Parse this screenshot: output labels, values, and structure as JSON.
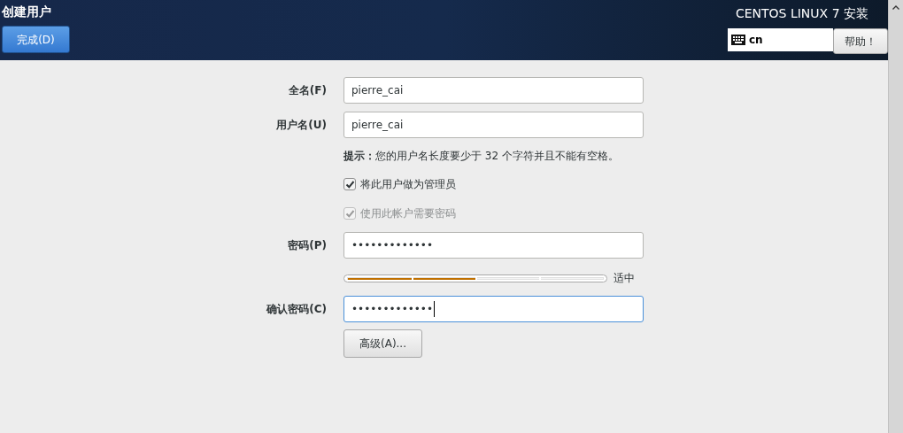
{
  "header": {
    "title": "创建用户",
    "done_button": "完成(D)",
    "product": "CENTOS LINUX 7 安装",
    "keyboard_layout": "cn",
    "help_button": "帮助！"
  },
  "fields": [
    {
      "label": "全名(F)",
      "value": "pierre_cai",
      "focused": false
    },
    {
      "label": "用户名(U)",
      "value": "pierre_cai",
      "focused": false
    }
  ],
  "hint": "**提示：**您的用户名长度要少于 32 个字符并且不能有空格。",
  "checkboxes": [
    {
      "label": "将此用户做为管理员",
      "checked": true,
      "disabled": false
    },
    {
      "label": "使用此帐户需要密码",
      "checked": true,
      "disabled": true
    }
  ],
  "password": {
    "label": "密码(P)",
    "value": "•••••••••••••",
    "focused": false
  },
  "strength": {
    "level": 0.5,
    "reading": "适中"
  },
  "confirm": {
    "label": "确认密码(C)",
    "value": "•••••••••••••",
    "focused": true
  },
  "advanced_button": "高级(A)..."
}
